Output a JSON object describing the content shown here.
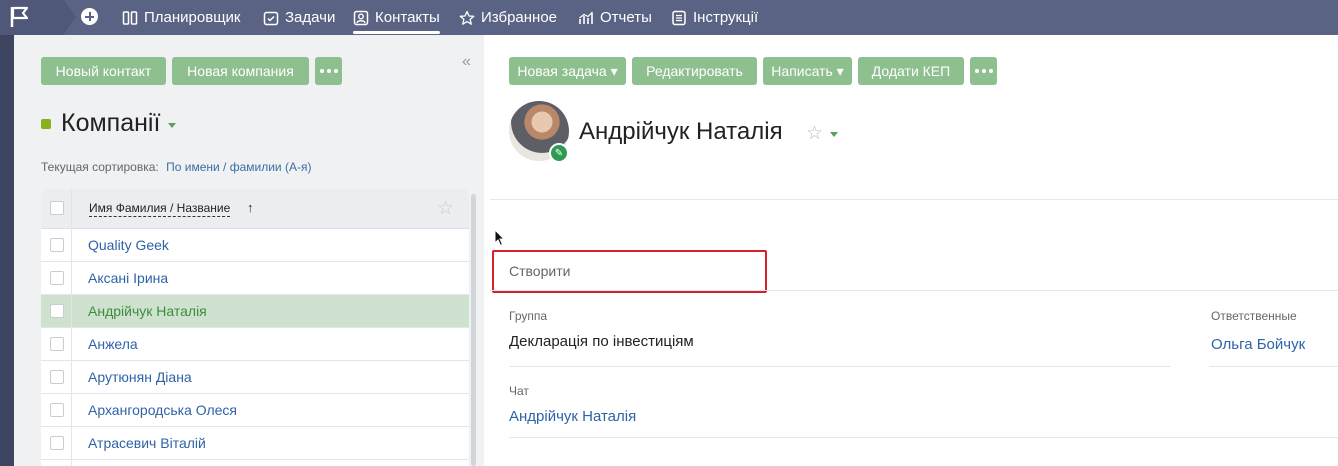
{
  "topbar": {
    "nav": [
      {
        "label": "Планировщик"
      },
      {
        "label": "Задачи"
      },
      {
        "label": "Контакты"
      },
      {
        "label": "Избранное"
      },
      {
        "label": "Отчеты"
      },
      {
        "label": "Інструкції"
      }
    ],
    "active_tab": "Контакты"
  },
  "left": {
    "buttons": {
      "new_contact": "Новый контакт",
      "new_company": "Новая компания"
    },
    "collapse_icon": "«",
    "section_title": "Компанії",
    "sort_label": "Текущая сортировка:",
    "sort_value": "По имени / фамилии (А-я)",
    "table": {
      "column_header": "Имя Фамилия / Название",
      "sort_arrow": "↑",
      "rows": [
        {
          "name": "Quality Geek"
        },
        {
          "name": "Аксані Ірина"
        },
        {
          "name": "Андрійчук Наталія"
        },
        {
          "name": "Анжела"
        },
        {
          "name": "Арутюнян Діана"
        },
        {
          "name": "Архангородська Олеся"
        },
        {
          "name": "Атрасевич Віталій"
        }
      ],
      "selected_row": "Андрійчук Наталія"
    }
  },
  "right": {
    "buttons": {
      "new_task": "Новая задача ▾",
      "edit": "Редактировать",
      "write": "Написать ▾",
      "add_kep": "Додати КЕП"
    },
    "contact_name": "Андрійчук Наталія",
    "create_label": "Створити",
    "fields": {
      "group_label": "Группа",
      "group_value": "Декларація по інвестиціям",
      "responsible_label": "Ответственные",
      "responsible_value": "Ольга Бойчук",
      "chat_label": "Чат",
      "chat_value": "Андрійчук Наталія"
    }
  },
  "colors": {
    "topbar": "#5a6383",
    "green_button": "#8ebf8e",
    "link": "#2e63a8",
    "selected_row": "#cfe2cf",
    "highlight_border": "#d6202a"
  }
}
